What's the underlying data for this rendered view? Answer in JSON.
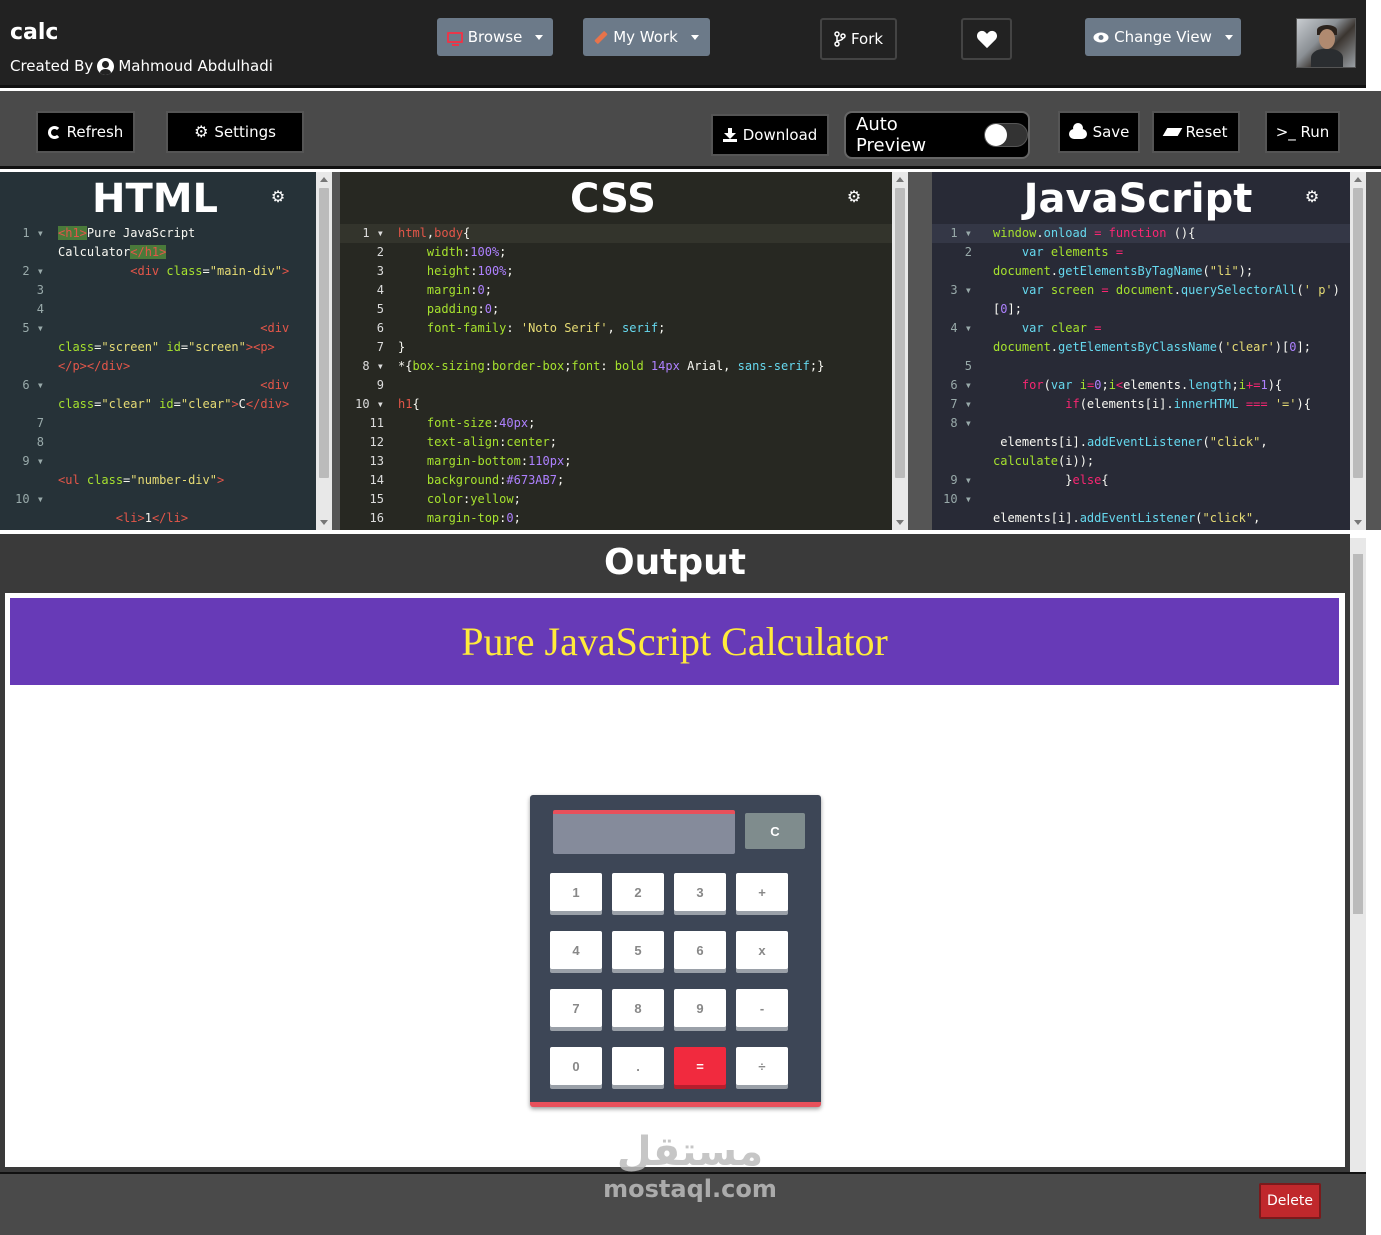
{
  "header": {
    "title": "calc",
    "created_by_label": "Created By",
    "author": "Mahmoud Abdulhadi",
    "browse_label": "Browse",
    "mywork_label": "My Work",
    "fork_label": "Fork",
    "change_view_label": "Change View"
  },
  "toolbar": {
    "refresh_label": "Refresh",
    "settings_label": "Settings",
    "download_label": "Download",
    "auto_preview_label": "Auto Preview",
    "auto_preview_on": false,
    "save_label": "Save",
    "reset_label": "Reset",
    "run_label": ">_ Run"
  },
  "editors": {
    "html_title": "HTML",
    "css_title": "CSS",
    "js_title": "JavaScript"
  },
  "output": {
    "title": "Output",
    "page_heading": "Pure JavaScript Calculator",
    "clear_key": "C",
    "keys": [
      "1",
      "2",
      "3",
      "+",
      "4",
      "5",
      "6",
      "x",
      "7",
      "8",
      "9",
      "-",
      "0",
      ".",
      "=",
      "÷"
    ]
  },
  "footer": {
    "delete_label": "Delete",
    "watermark_arabic": "مستقل",
    "watermark_latin": "mostaql.com"
  },
  "colors": {
    "heading_bg": "#673AB7",
    "heading_text": "#ffeb3b",
    "equals_key": "#f12a3e",
    "delete_button": "#c0282c"
  }
}
